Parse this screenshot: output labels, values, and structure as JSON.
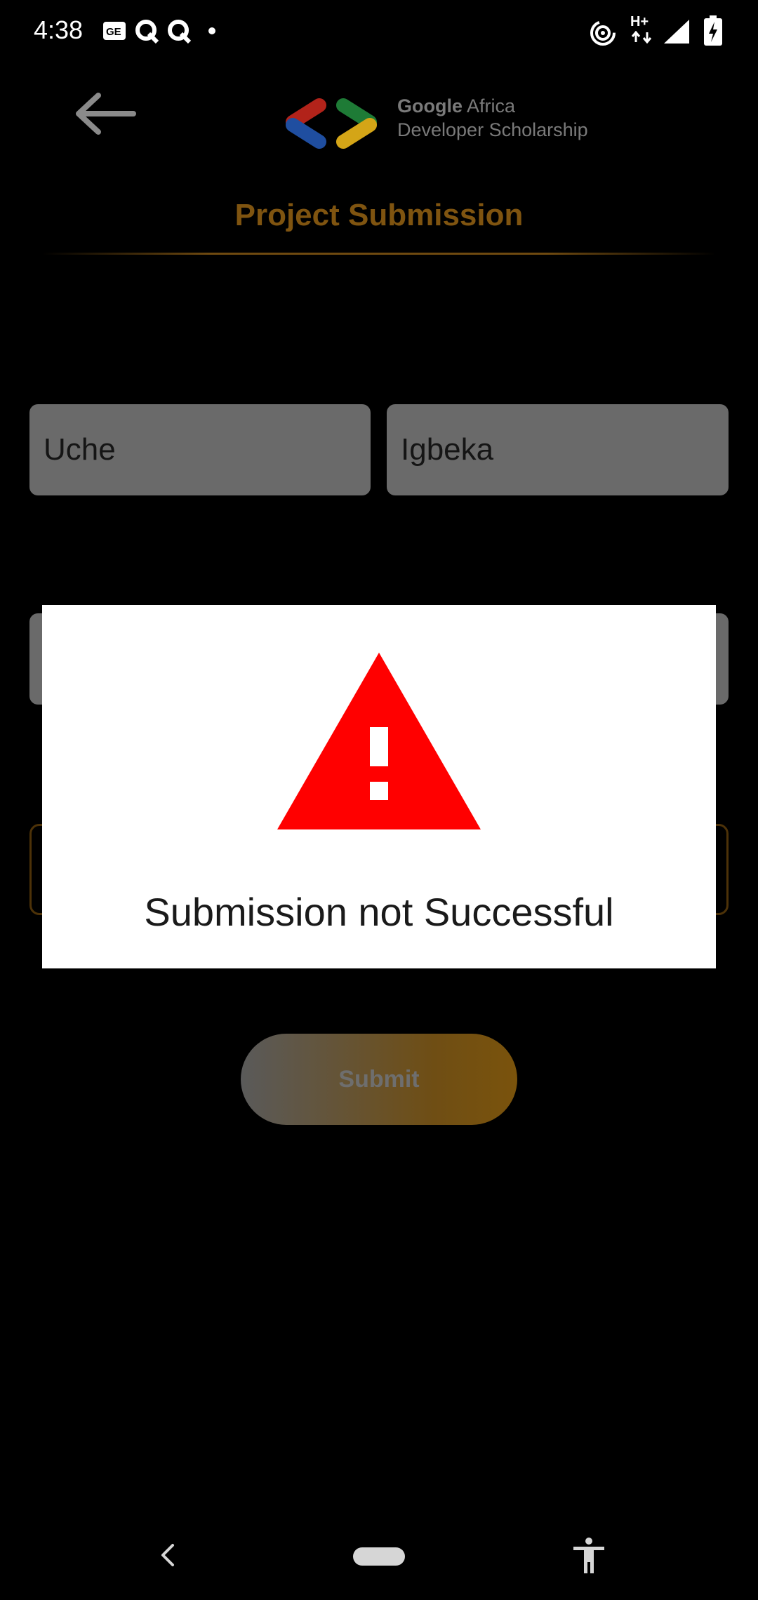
{
  "status_bar": {
    "time": "4:38",
    "network_label": "H+",
    "icons": [
      "news-icon",
      "q-icon",
      "q-icon",
      "dot-icon",
      "hotspot-icon",
      "data-arrows-icon",
      "signal-icon",
      "battery-charging-icon"
    ]
  },
  "header": {
    "back_icon": "arrow-left-icon",
    "logo_google": "Google",
    "logo_africa": "Africa",
    "logo_line2": "Developer Scholarship",
    "title": "Project Submission"
  },
  "form": {
    "first_name_value": "Uche",
    "last_name_value": "Igbeka",
    "submit_label": "Submit"
  },
  "dialog": {
    "icon": "warning-icon",
    "message": "Submission not Successful"
  },
  "colors": {
    "accent": "#7f5410",
    "warning": "#ff0000",
    "dialog_bg": "#ffffff"
  },
  "nav_bar": {
    "icons": [
      "back-chevron-icon",
      "home-pill-icon",
      "accessibility-icon"
    ]
  }
}
